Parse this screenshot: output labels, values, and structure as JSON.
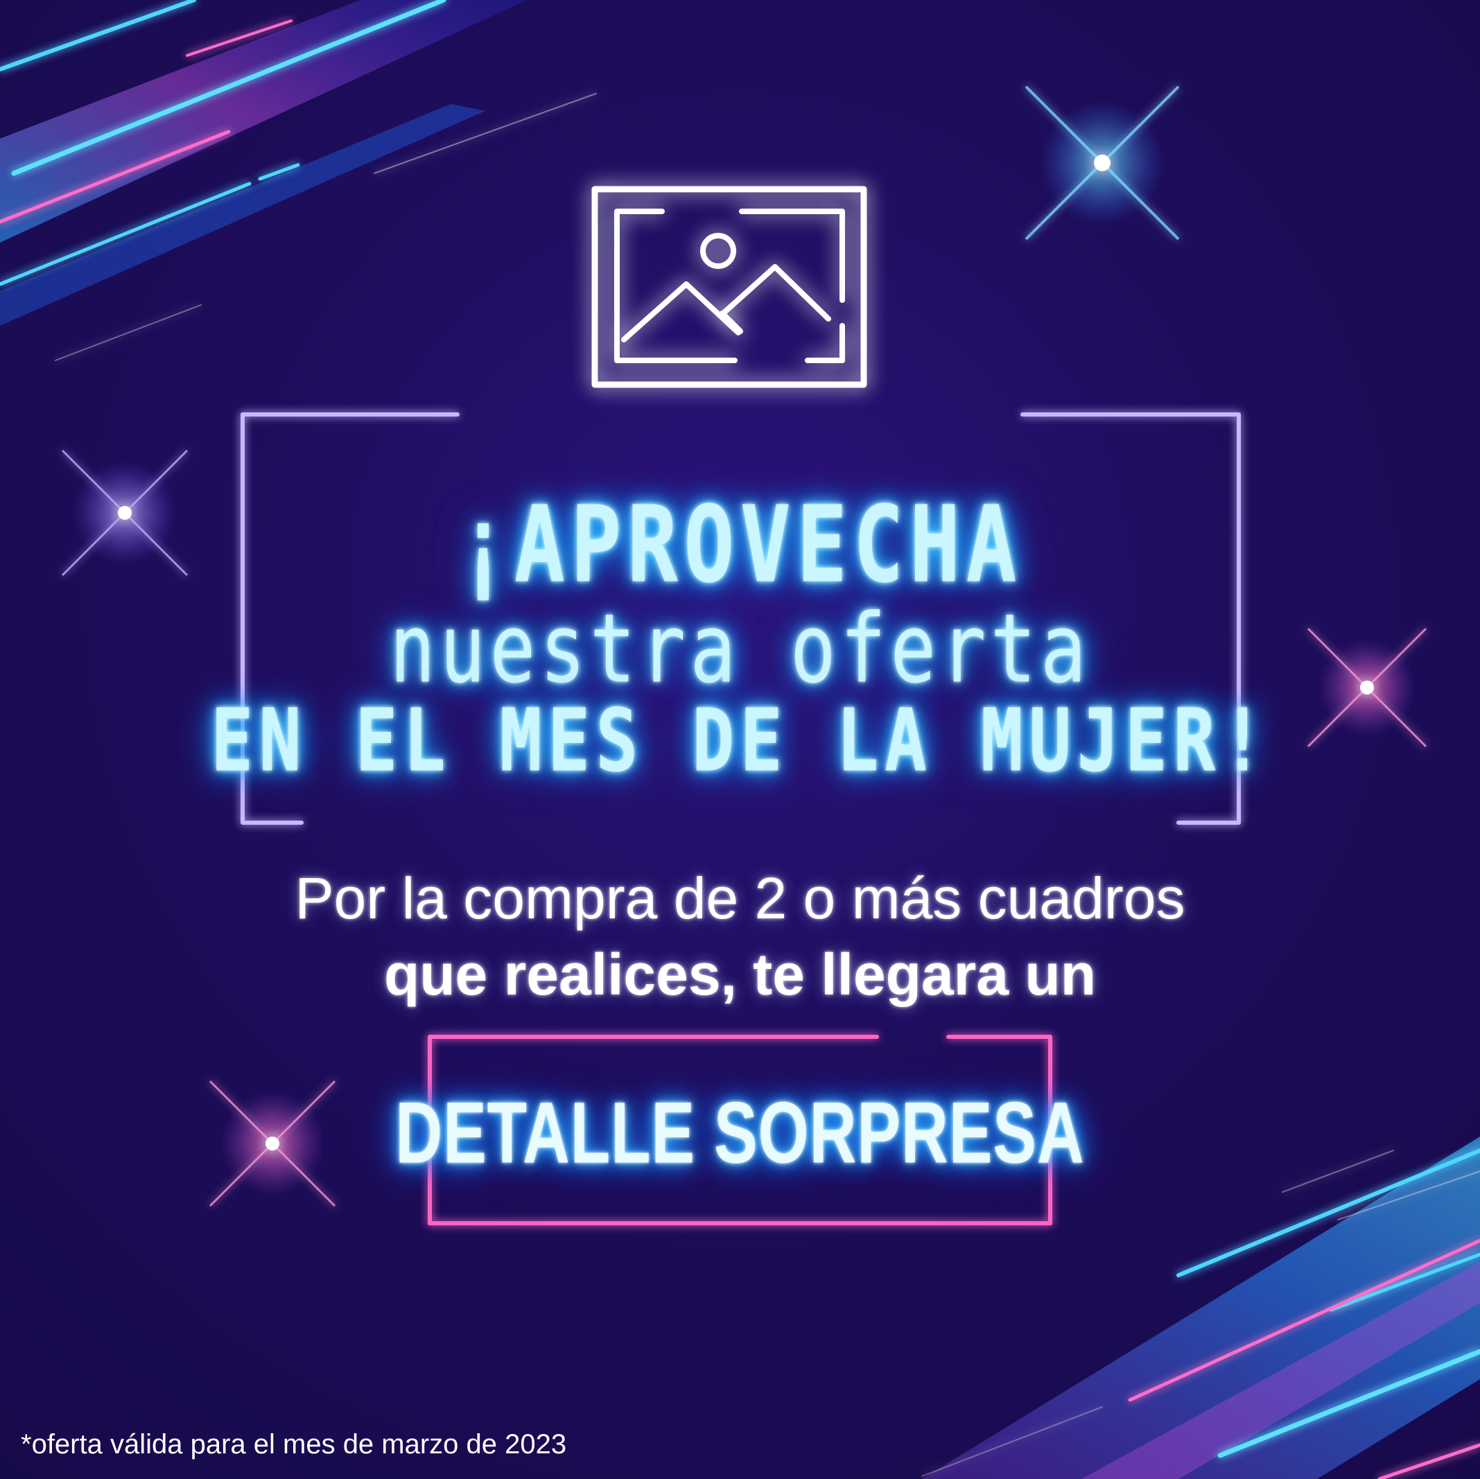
{
  "promo": {
    "headline_1": "¡APROVECHA",
    "headline_2": "nuestra oferta",
    "headline_3": "EN EL MES DE LA MUJER!",
    "body_line_1": "Por la compra de 2 o más cuadros",
    "body_line_2": "que realices, te llegara un",
    "cta": "DETALLE SORPRESA",
    "footnote": "*oferta válida para el mes de marzo de 2023"
  },
  "icons": {
    "hero": "picture-frame-icon"
  },
  "colors": {
    "background": "#1f0f5a",
    "neon_cyan": "#4fd6ff",
    "neon_pink": "#ff66c4",
    "neon_lavender": "#cbb7ff"
  }
}
